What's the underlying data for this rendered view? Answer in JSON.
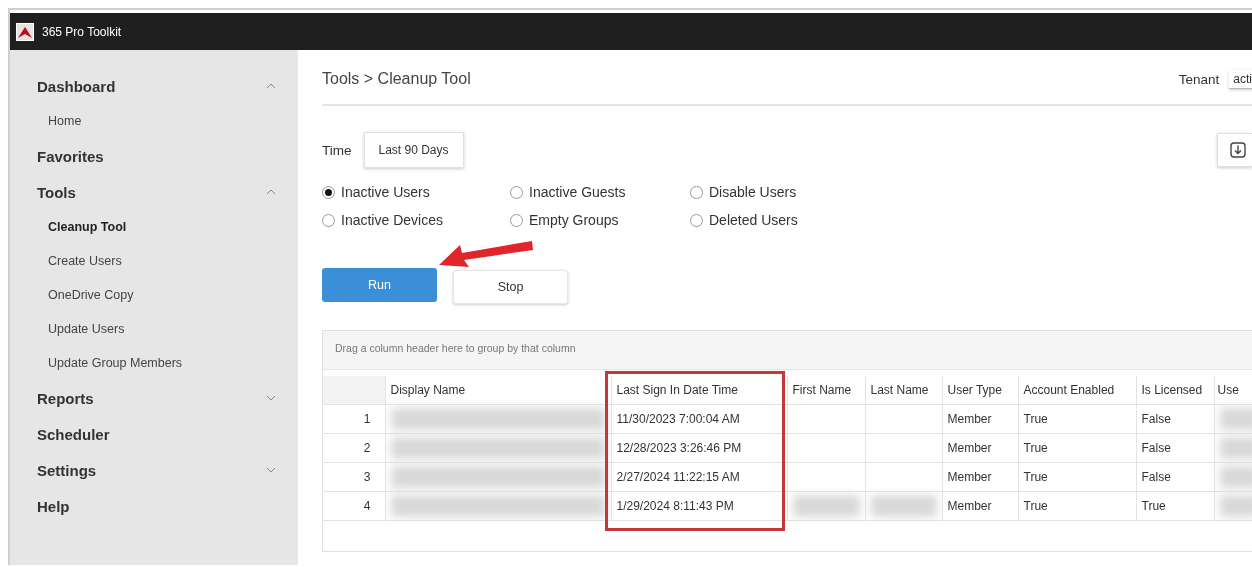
{
  "window": {
    "title": "365 Pro Toolkit"
  },
  "sidebar": {
    "items": [
      {
        "label": "Dashboard",
        "expanded": true,
        "children": [
          {
            "label": "Home",
            "selected": false
          }
        ]
      },
      {
        "label": "Favorites"
      },
      {
        "label": "Tools",
        "expanded": true,
        "children": [
          {
            "label": "Cleanup Tool",
            "selected": true
          },
          {
            "label": "Create Users",
            "selected": false
          },
          {
            "label": "OneDrive Copy",
            "selected": false
          },
          {
            "label": "Update Users",
            "selected": false
          },
          {
            "label": "Update Group Members",
            "selected": false
          }
        ]
      },
      {
        "label": "Reports",
        "expanded": false
      },
      {
        "label": "Scheduler"
      },
      {
        "label": "Settings",
        "expanded": false
      },
      {
        "label": "Help"
      }
    ]
  },
  "header": {
    "breadcrumb": "Tools > Cleanup Tool",
    "tenant_label": "Tenant",
    "tenant_value": "acti"
  },
  "time": {
    "label": "Time",
    "value": "Last 90 Days"
  },
  "options": [
    {
      "label": "Inactive Users",
      "selected": true
    },
    {
      "label": "Inactive Guests",
      "selected": false
    },
    {
      "label": "Disable Users",
      "selected": false
    },
    {
      "label": "Inactive Devices",
      "selected": false
    },
    {
      "label": "Empty Groups",
      "selected": false
    },
    {
      "label": "Deleted Users",
      "selected": false
    }
  ],
  "buttons": [
    {
      "label": "Run",
      "kind": "primary"
    },
    {
      "label": "Stop",
      "kind": "secondary"
    }
  ],
  "annotations": [
    {
      "kind": "arrow"
    }
  ],
  "table": {
    "group_hint": "Drag a column header here to group by that column",
    "columns": [
      {
        "highlighted": false
      },
      {
        "label": "Display Name",
        "highlighted": false
      },
      {
        "label": "Last Sign In Date Time",
        "highlighted": true
      },
      {
        "label": "First Name",
        "highlighted": false
      },
      {
        "label": "Last Name",
        "highlighted": false
      },
      {
        "label": "User Type",
        "highlighted": false
      },
      {
        "label": "Account Enabled",
        "highlighted": false
      },
      {
        "label": "Is Licensed",
        "highlighted": false
      },
      {
        "label": "Use",
        "highlighted": false
      }
    ],
    "rows": [
      {
        "cells": [
          {
            "text": "1"
          },
          {
            "redacted": true
          },
          {
            "text": "11/30/2023 7:00:04 AM"
          },
          {},
          {},
          {
            "text": "Member"
          },
          {
            "text": "True"
          },
          {
            "text": "False"
          },
          {
            "redacted": true
          }
        ]
      },
      {
        "cells": [
          {
            "text": "2"
          },
          {
            "redacted": true
          },
          {
            "text": "12/28/2023 3:26:46 PM"
          },
          {},
          {},
          {
            "text": "Member"
          },
          {
            "text": "True"
          },
          {
            "text": "False"
          },
          {
            "redacted": true
          }
        ]
      },
      {
        "cells": [
          {
            "text": "3"
          },
          {
            "redacted": true
          },
          {
            "text": "2/27/2024 11:22:15 AM"
          },
          {},
          {},
          {
            "text": "Member"
          },
          {
            "text": "True"
          },
          {
            "text": "False"
          },
          {
            "redacted": true
          }
        ]
      },
      {
        "cells": [
          {
            "text": "4"
          },
          {
            "redacted": true
          },
          {
            "text": "1/29/2024 8:11:43 PM"
          },
          {
            "redacted": true
          },
          {
            "redacted": true
          },
          {
            "text": "Member"
          },
          {
            "text": "True"
          },
          {
            "text": "True"
          },
          {
            "redacted": true
          }
        ]
      }
    ]
  }
}
